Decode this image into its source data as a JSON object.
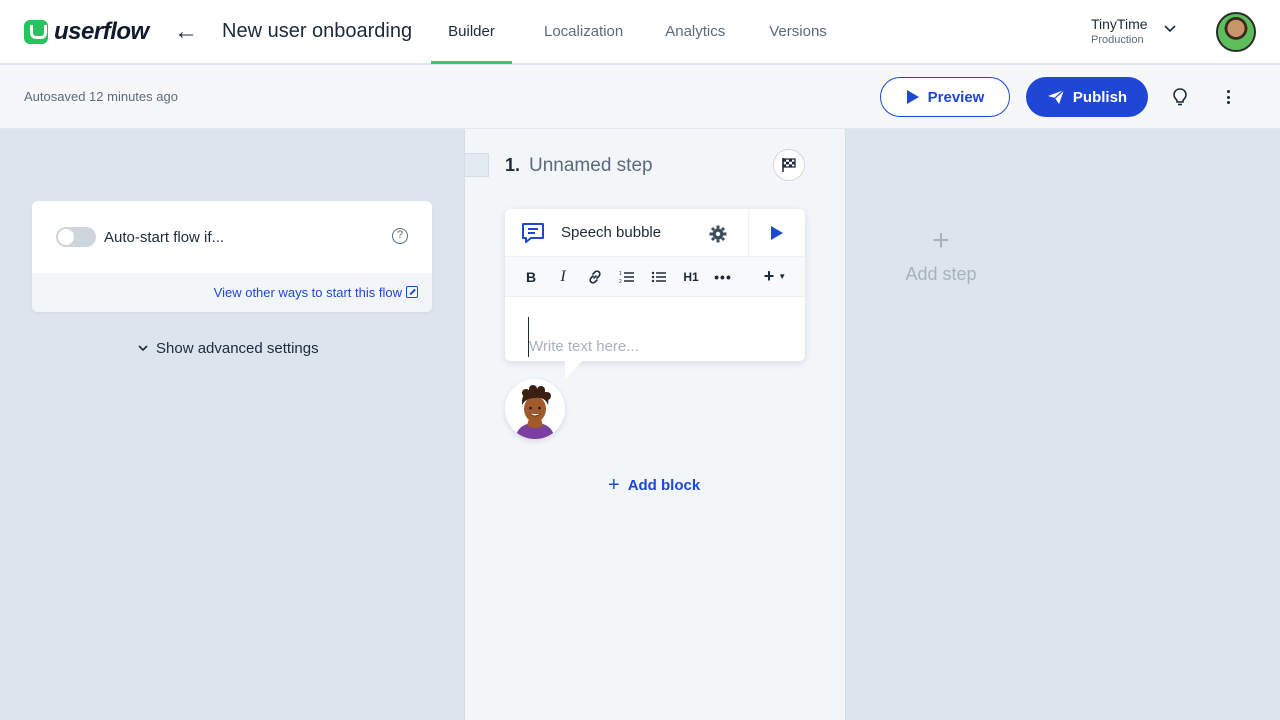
{
  "app": {
    "logo_text": "userflow",
    "flow_title": "New user onboarding"
  },
  "tabs": [
    {
      "label": "Builder",
      "active": true
    },
    {
      "label": "Localization",
      "active": false
    },
    {
      "label": "Analytics",
      "active": false
    },
    {
      "label": "Versions",
      "active": false
    }
  ],
  "org": {
    "name": "TinyTime",
    "environment": "Production"
  },
  "toolbar": {
    "autosave_text": "Autosaved 12 minutes ago",
    "preview_label": "Preview",
    "publish_label": "Publish"
  },
  "start_settings": {
    "auto_start_label": "Auto-start flow if...",
    "auto_start_enabled": false,
    "help_glyph": "?",
    "other_ways_link": "View other ways to start this flow",
    "advanced_toggle": "Show advanced settings"
  },
  "step": {
    "number": "1.",
    "name": "Unnamed step",
    "block": {
      "type_label": "Speech bubble",
      "placeholder": "Write text here...",
      "toolbar": [
        "B",
        "I",
        "link",
        "ordered-list",
        "bullet-list",
        "H1",
        "more",
        "insert"
      ]
    },
    "add_block_label": "Add block"
  },
  "add_step_label": "Add step",
  "colors": {
    "primary": "#1e47d6",
    "accent_green": "#2ecc71",
    "canvas": "#dce5ed"
  }
}
